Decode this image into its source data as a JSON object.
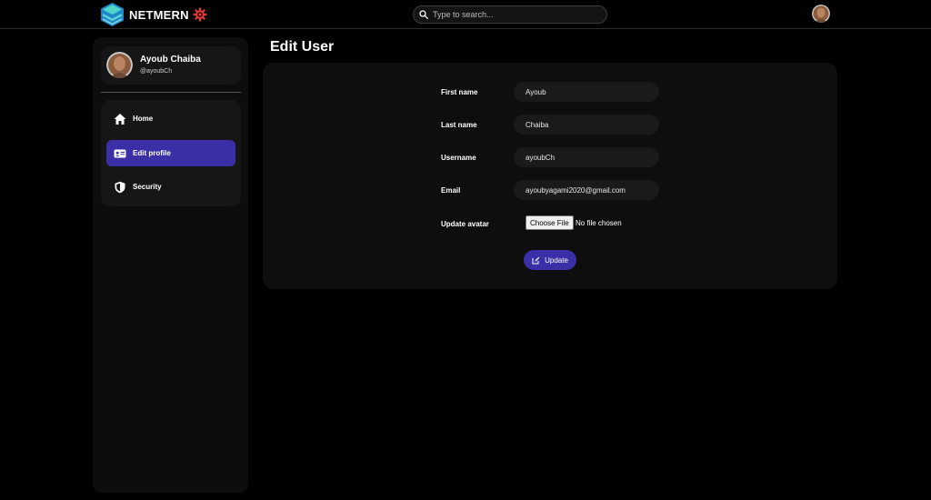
{
  "header": {
    "brand_name": "NETMERN",
    "logo_icon": "netmern-logo-icon",
    "theme_icon": "gear-icon",
    "search_placeholder": "Type to search...",
    "colors": {
      "accent": "#3b2fa8",
      "theme_icon": "#e53935",
      "logo_top": "#4dd6c8",
      "logo_bottom": "#1e88c9"
    }
  },
  "sidebar": {
    "profile": {
      "name": "Ayoub Chaiba",
      "handle": "@ayoubCh"
    },
    "items": [
      {
        "label": "Home",
        "icon": "home-icon",
        "active": false
      },
      {
        "label": "Edit profile",
        "icon": "id-card-icon",
        "active": true
      },
      {
        "label": "Security",
        "icon": "shield-icon",
        "active": false
      }
    ]
  },
  "main": {
    "title": "Edit User",
    "form": {
      "first_name": {
        "label": "First name",
        "value": "Ayoub"
      },
      "last_name": {
        "label": "Last name",
        "value": "Chaiba"
      },
      "username": {
        "label": "Username",
        "value": "ayoubCh"
      },
      "email": {
        "label": "Email",
        "value": "ayoubyagami2020@gmail.com"
      },
      "avatar": {
        "label": "Update avatar",
        "button": "Choose File",
        "status": "No file chosen"
      },
      "submit": {
        "label": "Update",
        "icon": "edit-icon"
      }
    }
  }
}
